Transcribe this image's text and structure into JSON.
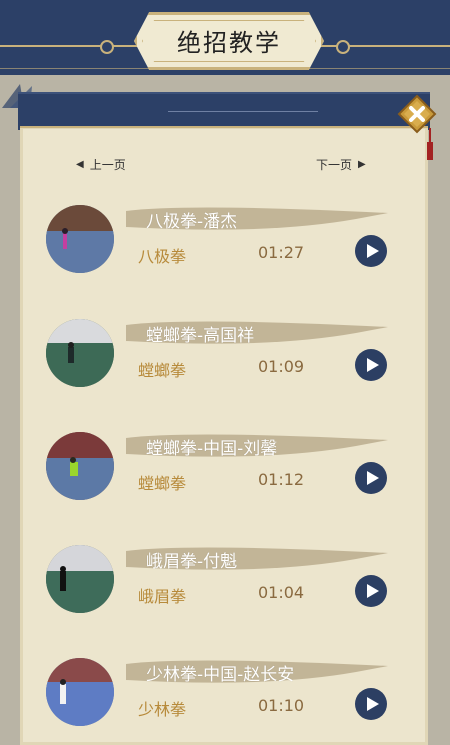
{
  "header": {
    "title": "绝招教学"
  },
  "pagination": {
    "prev_label": "上一页",
    "next_label": "下一页"
  },
  "videos": [
    {
      "title": "八极拳-潘杰",
      "style": "八极拳",
      "duration": "01:27"
    },
    {
      "title": "螳螂拳-高国祥",
      "style": "螳螂拳",
      "duration": "01:09"
    },
    {
      "title": "螳螂拳-中国-刘馨",
      "style": "螳螂拳",
      "duration": "01:12"
    },
    {
      "title": "峨眉拳-付魁",
      "style": "峨眉拳",
      "duration": "01:04"
    },
    {
      "title": "少林拳-中国-赵长安",
      "style": "少林拳",
      "duration": "01:10"
    }
  ],
  "colors": {
    "navy": "#2c4067",
    "gold": "#c9b27c",
    "parchment": "#ece5cd",
    "accent_text": "#b78a3a"
  },
  "icons": {
    "close": "close-icon",
    "play": "play-icon",
    "prev": "triangle-left-icon",
    "next": "triangle-right-icon"
  }
}
